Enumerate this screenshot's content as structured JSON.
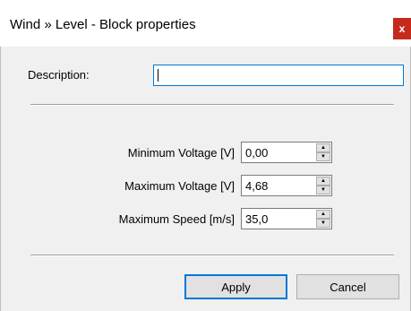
{
  "window": {
    "title": "Wind » Level - Block properties",
    "close_glyph": "x"
  },
  "description": {
    "label": "Description:",
    "value": ""
  },
  "fields": [
    {
      "label": "Minimum Voltage [V]",
      "value": "0,00"
    },
    {
      "label": "Maximum Voltage [V]",
      "value": "4,68"
    },
    {
      "label": "Maximum Speed [m/s]",
      "value": "35,0"
    }
  ],
  "buttons": {
    "apply": "Apply",
    "cancel": "Cancel"
  },
  "colors": {
    "close": "#c42b1c",
    "focus": "#0078d7",
    "dialog_bg": "#f0f0f0"
  }
}
